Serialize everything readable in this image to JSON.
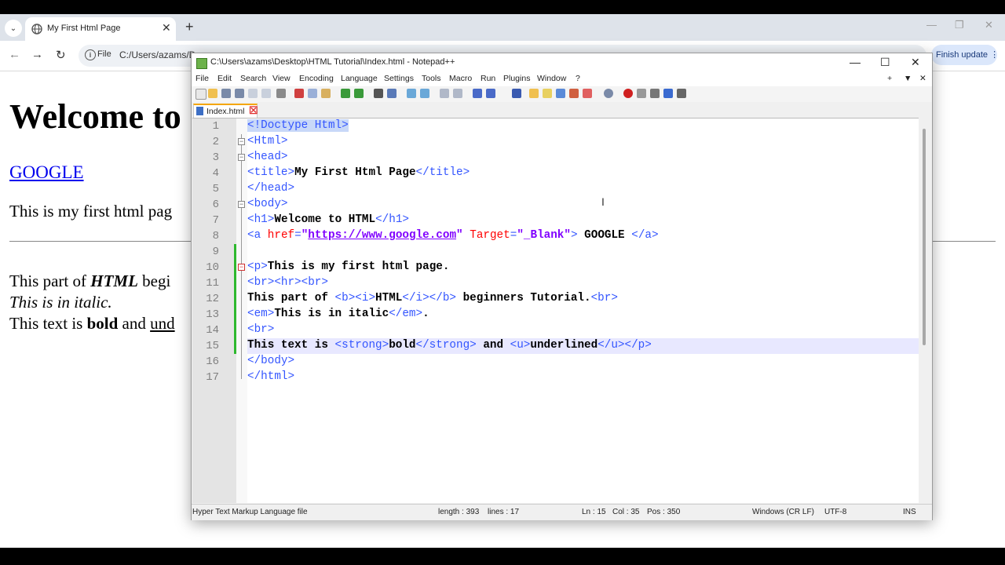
{
  "browser": {
    "tab_title": "My First Html Page",
    "address_scheme": "File",
    "address_url": "C:/Users/azams/D",
    "finish_update": "Finish update",
    "page": {
      "h1": "Welcome to",
      "link": "GOOGLE",
      "p1": "This is my first html pag",
      "line1_pre": "This part of ",
      "line1_bi": "HTML",
      "line1_post": " begi",
      "line2": "This is in italic.",
      "line3_pre": "This text is ",
      "line3_bold": "bold",
      "line3_mid": " and ",
      "line3_u": "und"
    }
  },
  "notepad": {
    "title": "C:\\Users\\azams\\Desktop\\HTML Tutorial\\Index.html - Notepad++",
    "menu": [
      "File",
      "Edit",
      "Search",
      "View",
      "Encoding",
      "Language",
      "Settings",
      "Tools",
      "Macro",
      "Run",
      "Plugins",
      "Window",
      "?"
    ],
    "menu_right": [
      "+",
      "▼",
      "✕"
    ],
    "doc_tab": "Index.html",
    "line_numbers": [
      "1",
      "2",
      "3",
      "4",
      "5",
      "6",
      "7",
      "8",
      "9",
      "10",
      "11",
      "12",
      "13",
      "14",
      "15",
      "16",
      "17"
    ],
    "status": {
      "filetype": "Hyper Text Markup Language file",
      "length": "length : 393",
      "lines": "lines : 17",
      "ln": "Ln : 15",
      "col": "Col : 35",
      "pos": "Pos : 350",
      "eol": "Windows (CR LF)",
      "encoding": "UTF-8",
      "mode": "INS"
    },
    "code": {
      "l1": "!Doctype Html",
      "l2": "Html",
      "l3": "head",
      "l4_open": "title",
      "l4_text": "My First Html Page",
      "l4_close": "/title",
      "l5": "/head",
      "l6": "body",
      "l7_open": "h1",
      "l7_text": "Welcome to HTML",
      "l7_close": "/h1",
      "l8_tag": "a",
      "l8_attr1": "href",
      "l8_val1": "https://www.google.com",
      "l8_attr2": "Target",
      "l8_val2": "_Blank",
      "l8_text": " GOOGLE ",
      "l8_close": "/a",
      "l10_tag": "p",
      "l10_text": "This is my first html page.",
      "l11": "<br><hr><br>",
      "l12_a": "This part of ",
      "l12_t1": "<b><i>",
      "l12_b": "HTML",
      "l12_t2": "</i></b>",
      "l12_c": " beginners Tutorial.",
      "l12_t3": "<br>",
      "l13_t1": "<em>",
      "l13_text": "This is in italic",
      "l13_t2": "</em>",
      "l13_end": ".",
      "l14": "<br>",
      "l15_a": "This text is ",
      "l15_t1": "<strong>",
      "l15_b": "bold",
      "l15_t2": "</strong>",
      "l15_c": " and ",
      "l15_t3": "<u>",
      "l15_d": "underlined",
      "l15_t4": "</u></p>",
      "l16": "</body>",
      "l17": "</html>"
    }
  },
  "colors": {
    "tag": "#3355ff",
    "attr": "#ff0000",
    "value": "#8000ff",
    "current_line": "#e8e8ff"
  }
}
